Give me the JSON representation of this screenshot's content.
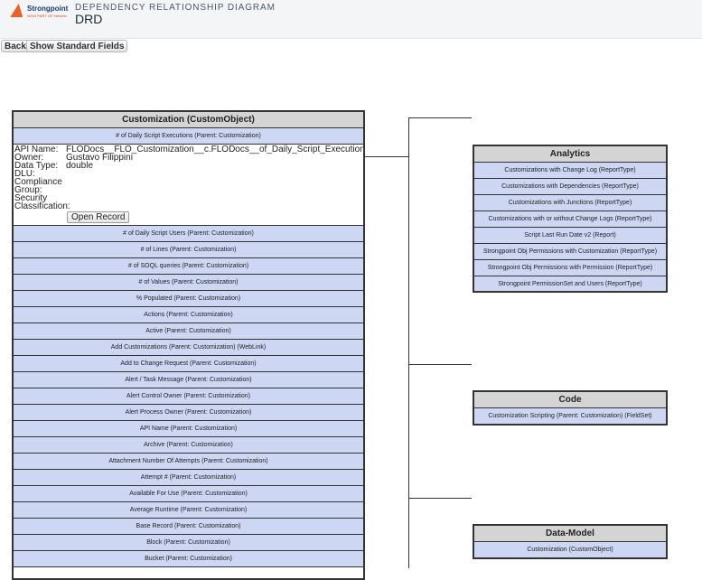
{
  "header": {
    "logo_text": "Strongpoint",
    "logo_sub": "NOW PART OF Netwrix",
    "subtitle": "DEPENDENCY RELATIONSHIP DIAGRAM",
    "title": "DRD"
  },
  "toolbar": {
    "back_label": "Back",
    "show_fields_label": "Show Standard Fields"
  },
  "customization": {
    "title": "Customization (CustomObject)",
    "first_item": "# of Daily Script Executions (Parent: Customization)",
    "details": [
      {
        "label": "API Name:",
        "value": "FLODocs__FLO_Customization__c.FLODocs__of_Daily_Script_Executions__c"
      },
      {
        "label": "Owner:",
        "value": "Gustavo Filippini"
      },
      {
        "label": "Data Type:",
        "value": "double"
      },
      {
        "label": "DLU:",
        "value": ""
      },
      {
        "label": "Compliance",
        "value": ""
      },
      {
        "label": "Group:",
        "value": ""
      },
      {
        "label": "Security",
        "value": ""
      },
      {
        "label": "Classification:",
        "value": ""
      }
    ],
    "open_record_label": "Open Record",
    "items": [
      "# of Daily Script Users (Parent: Customization)",
      "# of Lines (Parent: Customization)",
      "# of SOQL queries (Parent: Customization)",
      "# of Values (Parent: Customization)",
      "% Populated (Parent: Customization)",
      "Actions (Parent: Customization)",
      "Active (Parent: Customization)",
      "Add Customizations (Parent: Customization) (WebLink)",
      "Add to Change Request (Parent: Customization)",
      "Alert / Task Message (Parent: Customization)",
      "Alert Control Owner (Parent: Customization)",
      "Alert Process Owner (Parent: Customization)",
      "API Name (Parent: Customization)",
      "Archive (Parent: Customization)",
      "Attachment Number Of Attempts (Parent: Customization)",
      "Attempt # (Parent: Customization)",
      "Available For Use (Parent: Customization)",
      "Average Runtime (Parent: Customization)",
      "Base Record (Parent: Customization)",
      "Block (Parent: Customization)",
      "Bucket (Parent: Customization)"
    ]
  },
  "analytics": {
    "title": "Analytics",
    "items": [
      "Customizations with Change Log (ReportType)",
      "Customizations with Dependencies (ReportType)",
      "Customizations with Junctions (ReportType)",
      "Customizations with or without Change Logs (ReportType)",
      "Script Last Run Date v2 (Report)",
      "Strongpoint Obj Permissions with Customization (ReportType)",
      "Strongpoint Obj Permissions with Permission (ReportType)",
      "Strongpoint PermissionSet and Users (ReportType)"
    ]
  },
  "code": {
    "title": "Code",
    "items": [
      "Customization Scripting (Parent: Customization) (FieldSet)"
    ]
  },
  "data_model": {
    "title": "Data-Model",
    "items": [
      "Customization (CustomObject)"
    ]
  }
}
